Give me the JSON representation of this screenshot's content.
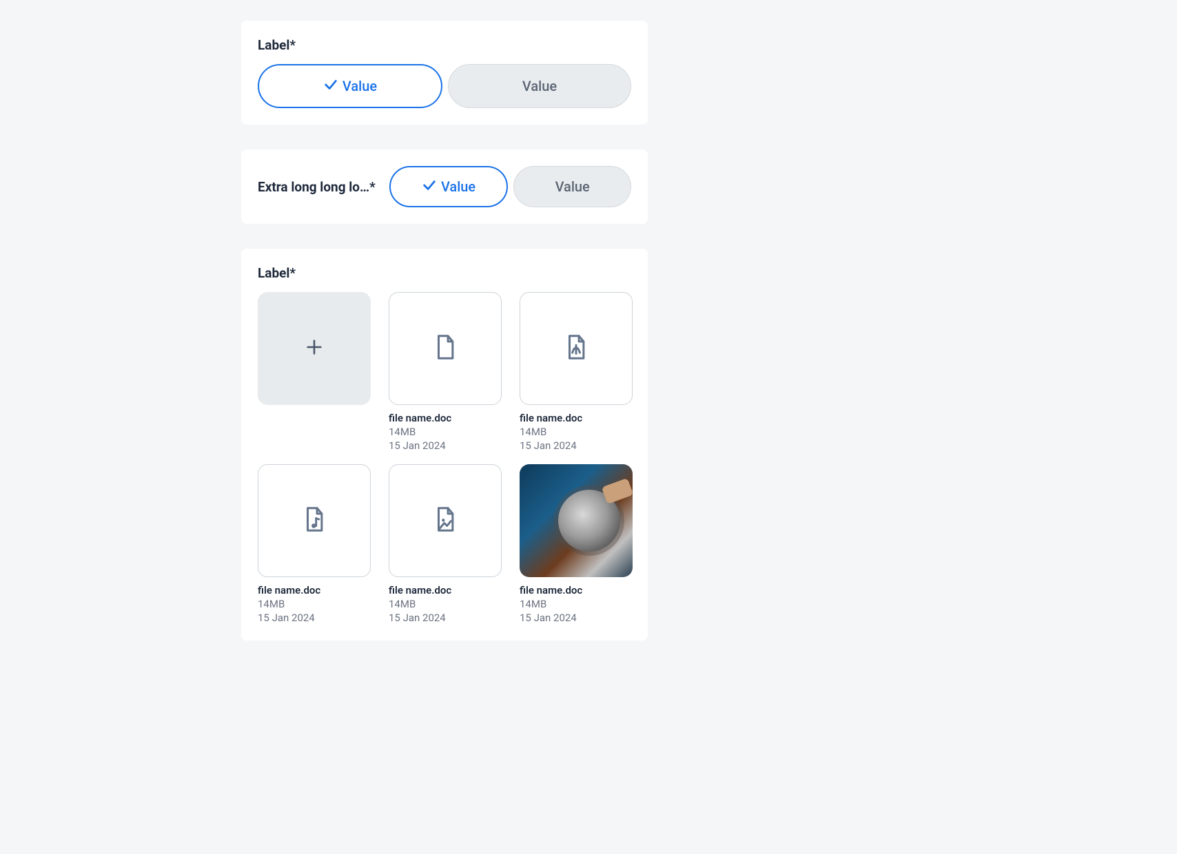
{
  "section1": {
    "label": "Label*",
    "options": [
      {
        "text": "Value",
        "selected": true
      },
      {
        "text": "Value",
        "selected": false
      }
    ]
  },
  "section2": {
    "label": "Extra long long lo…*",
    "options": [
      {
        "text": "Value",
        "selected": true
      },
      {
        "text": "Value",
        "selected": false
      }
    ]
  },
  "section3": {
    "label": "Label*",
    "files": [
      {
        "type": "add"
      },
      {
        "type": "doc",
        "name": "file name.doc",
        "size": "14MB",
        "date": "15 Jan 2024"
      },
      {
        "type": "pdf",
        "name": "file name.doc",
        "size": "14MB",
        "date": "15 Jan 2024"
      },
      {
        "type": "audio",
        "name": "file name.doc",
        "size": "14MB",
        "date": "15 Jan 2024"
      },
      {
        "type": "image-file",
        "name": "file name.doc",
        "size": "14MB",
        "date": "15 Jan 2024"
      },
      {
        "type": "photo",
        "name": "file name.doc",
        "size": "14MB",
        "date": "15 Jan 2024"
      }
    ]
  },
  "colors": {
    "accent": "#1a72e8",
    "muted": "#5b6472",
    "icon": "#64748b"
  }
}
